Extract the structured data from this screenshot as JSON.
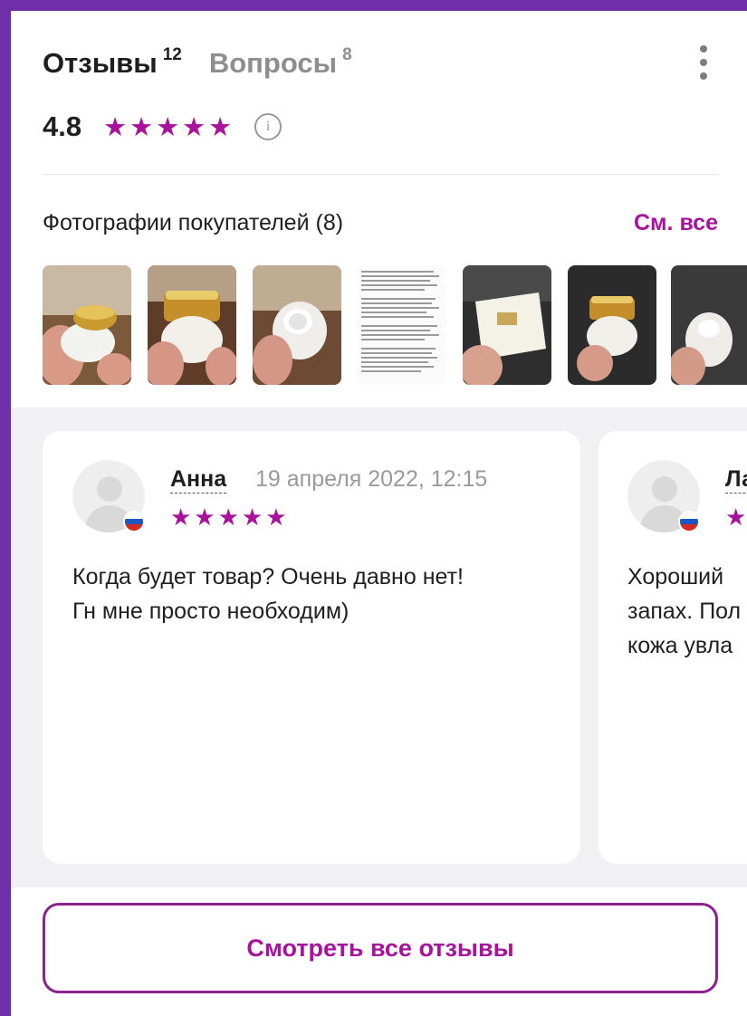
{
  "tabs": [
    {
      "label": "Отзывы",
      "count": "12"
    },
    {
      "label": "Вопросы",
      "count": "8"
    }
  ],
  "rating": {
    "value": "4.8",
    "stars": "★★★★★",
    "info_icon": "i"
  },
  "photos": {
    "title": "Фотографии покупателей (8)",
    "see_all": "См. все"
  },
  "reviews": [
    {
      "author": "Анна",
      "date": "19 апреля 2022, 12:15",
      "stars": "★★★★★",
      "text": "Когда будет товар? Очень давно нет!\nГн мне просто необходим)"
    },
    {
      "author": "Ла",
      "stars": "★",
      "text": "Хороший \nзапах. Пол\nкожа увла"
    }
  ],
  "cta": {
    "label": "Смотреть все отзывы"
  },
  "colors": {
    "accent": "#a8139c",
    "frame": "#6e2fa8",
    "muted": "#8e8e8e"
  },
  "icons": {
    "menu": "more-vertical-icon",
    "info": "info-icon",
    "flag": "russia-flag-icon",
    "avatar": "user-avatar-icon"
  }
}
